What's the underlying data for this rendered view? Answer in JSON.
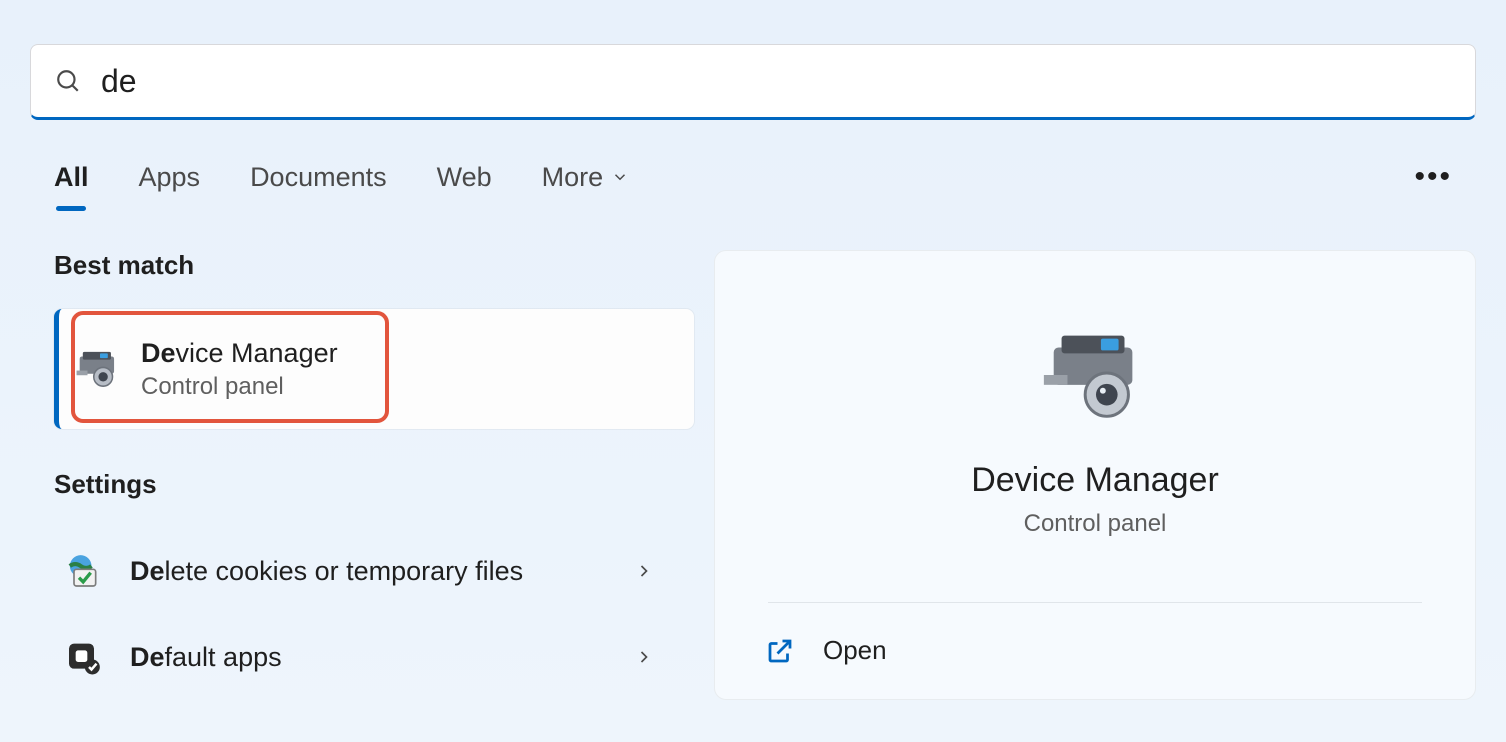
{
  "search": {
    "query": "de"
  },
  "tabs": {
    "all": "All",
    "apps": "Apps",
    "documents": "Documents",
    "web": "Web",
    "more": "More"
  },
  "sections": {
    "best_match": "Best match",
    "settings": "Settings"
  },
  "best_match": {
    "title_prefix": "De",
    "title_rest": "vice Manager",
    "subtitle": "Control panel"
  },
  "settings_items": [
    {
      "prefix": "De",
      "rest": "lete cookies or temporary files"
    },
    {
      "prefix": "De",
      "rest": "fault apps"
    }
  ],
  "detail": {
    "title": "Device Manager",
    "subtitle": "Control panel",
    "open": "Open"
  }
}
